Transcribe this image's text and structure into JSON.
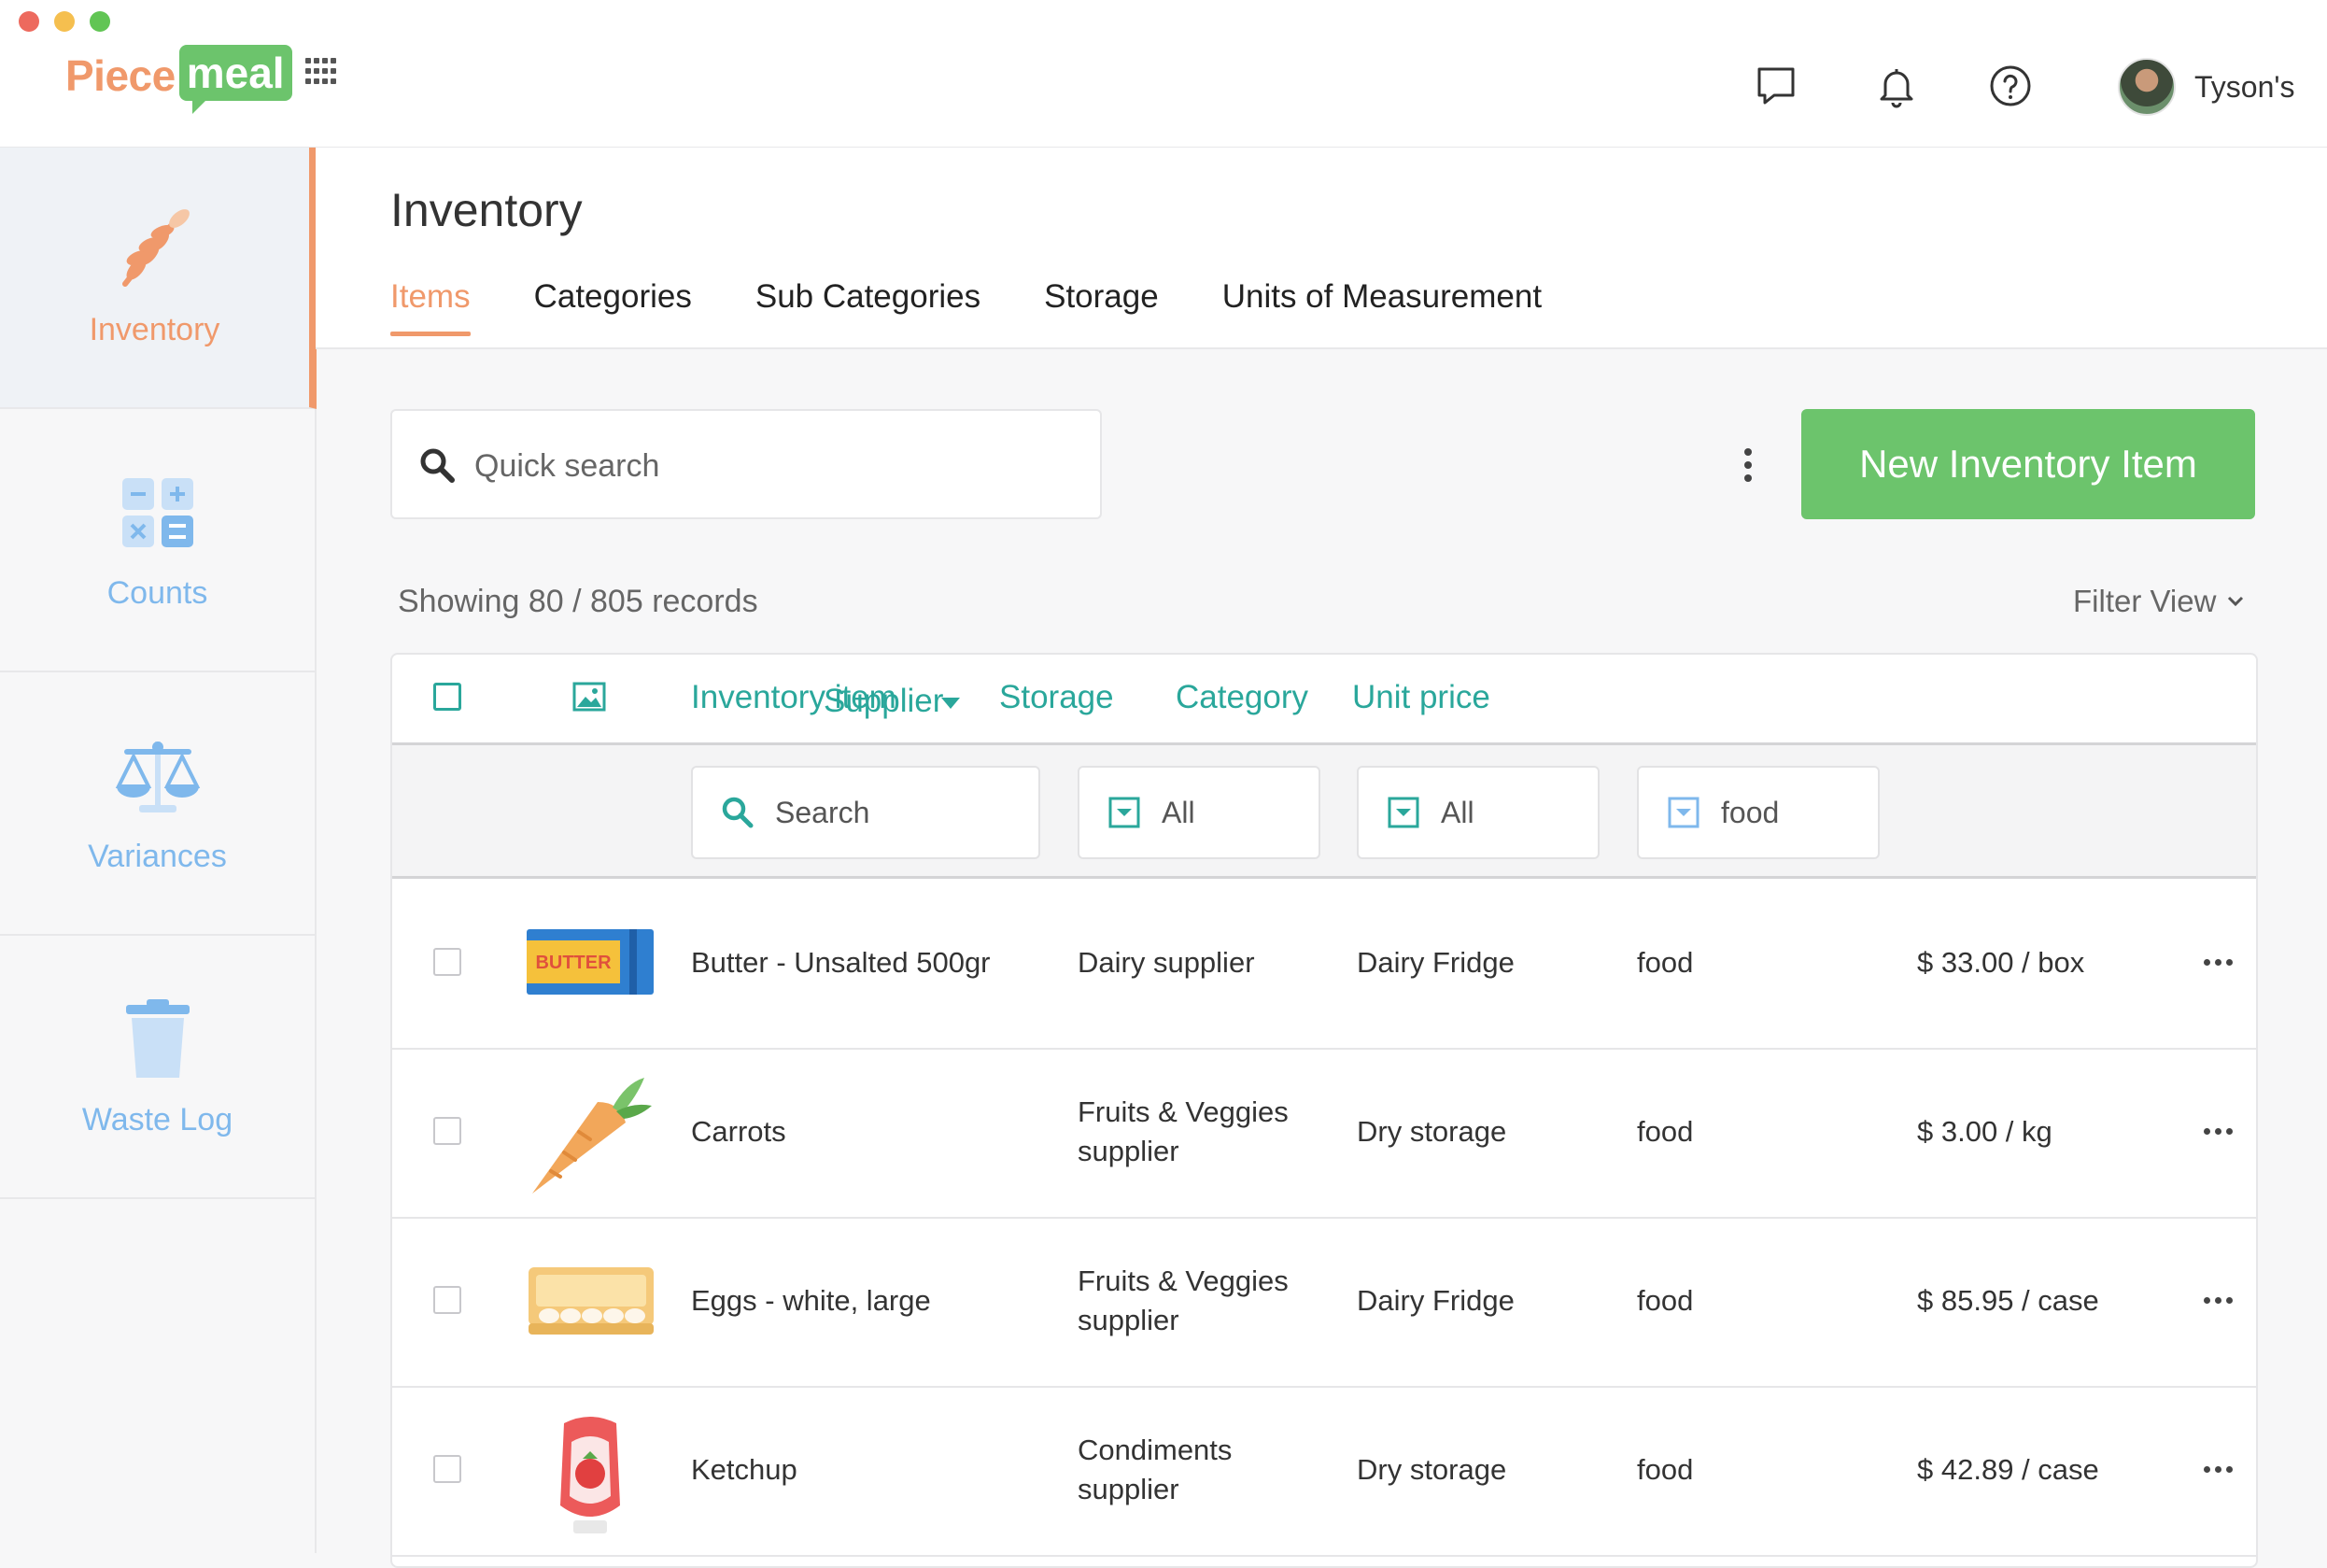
{
  "app": {
    "logo_part1": "Piece",
    "logo_part2": "meal",
    "user_name": "Tyson's",
    "colors": {
      "brand_orange": "#f0996b",
      "brand_green": "#6cc46c",
      "accent_teal": "#2aa79b",
      "side_blue": "#7fb8ec"
    }
  },
  "topbar": {
    "icons": [
      "apps-grid-icon",
      "chat-icon",
      "bell-icon",
      "help-icon"
    ]
  },
  "sidebar": {
    "items": [
      {
        "label": "Inventory",
        "icon": "wheat-icon",
        "active": true
      },
      {
        "label": "Counts",
        "icon": "calculator-icon",
        "active": false
      },
      {
        "label": "Variances",
        "icon": "scales-icon",
        "active": false
      },
      {
        "label": "Waste Log",
        "icon": "trash-icon",
        "active": false
      }
    ]
  },
  "page": {
    "title": "Inventory",
    "tabs": [
      {
        "label": "Items",
        "active": true
      },
      {
        "label": "Categories"
      },
      {
        "label": "Sub Categories"
      },
      {
        "label": "Storage"
      },
      {
        "label": "Units of Measurement"
      }
    ]
  },
  "toolbar": {
    "search_placeholder": "Quick search",
    "new_button": "New Inventory Item",
    "records_text": "Showing 80 / 805 records",
    "filter_view": "Filter View"
  },
  "table": {
    "columns": [
      "Inventory item",
      "Supplier",
      "Storage",
      "Category",
      "Unit price"
    ],
    "filters": {
      "item_placeholder": "Search",
      "supplier": "All",
      "storage": "All",
      "category": "food"
    },
    "rows": [
      {
        "item": "Butter - Unsalted 500gr",
        "supplier": [
          "Dairy supplier"
        ],
        "storage": "Dairy Fridge",
        "category": "food",
        "price": "$ 33.00 / box",
        "image": "butter",
        "image_text": "BUTTER"
      },
      {
        "item": "Carrots",
        "supplier": [
          "Fruits & Veggies",
          "supplier"
        ],
        "storage": "Dry storage",
        "category": "food",
        "price": "$ 3.00 / kg",
        "image": "carrot"
      },
      {
        "item": "Eggs - white, large",
        "supplier": [
          "Fruits & Veggies",
          "supplier"
        ],
        "storage": "Dairy Fridge",
        "category": "food",
        "price": "$ 85.95 / case",
        "image": "eggs"
      },
      {
        "item": "Ketchup",
        "supplier": [
          "Condiments",
          "supplier"
        ],
        "storage": "Dry storage",
        "category": "food",
        "price": "$ 42.89 / case",
        "image": "ketchup"
      }
    ]
  }
}
